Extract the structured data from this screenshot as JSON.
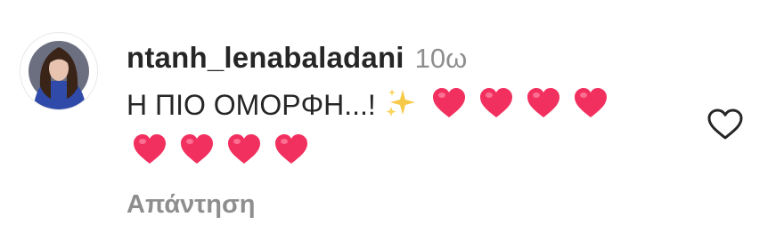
{
  "comment": {
    "username": "ntanh_lenabaladani",
    "timestamp": "10ω",
    "text": "Η ΠΙΟ ΟΜΟΡΦΗ...!",
    "emojis": [
      "sparkles",
      "heart",
      "heart",
      "heart",
      "heart",
      "heart",
      "heart",
      "heart",
      "heart"
    ],
    "like_icon": "heart-outline-icon",
    "reply_label": "Απάντηση"
  },
  "colors": {
    "text": "#262626",
    "secondary": "#8e8e8e",
    "heart_emoji": "#f2305f",
    "sparkle": "#f7c948"
  }
}
